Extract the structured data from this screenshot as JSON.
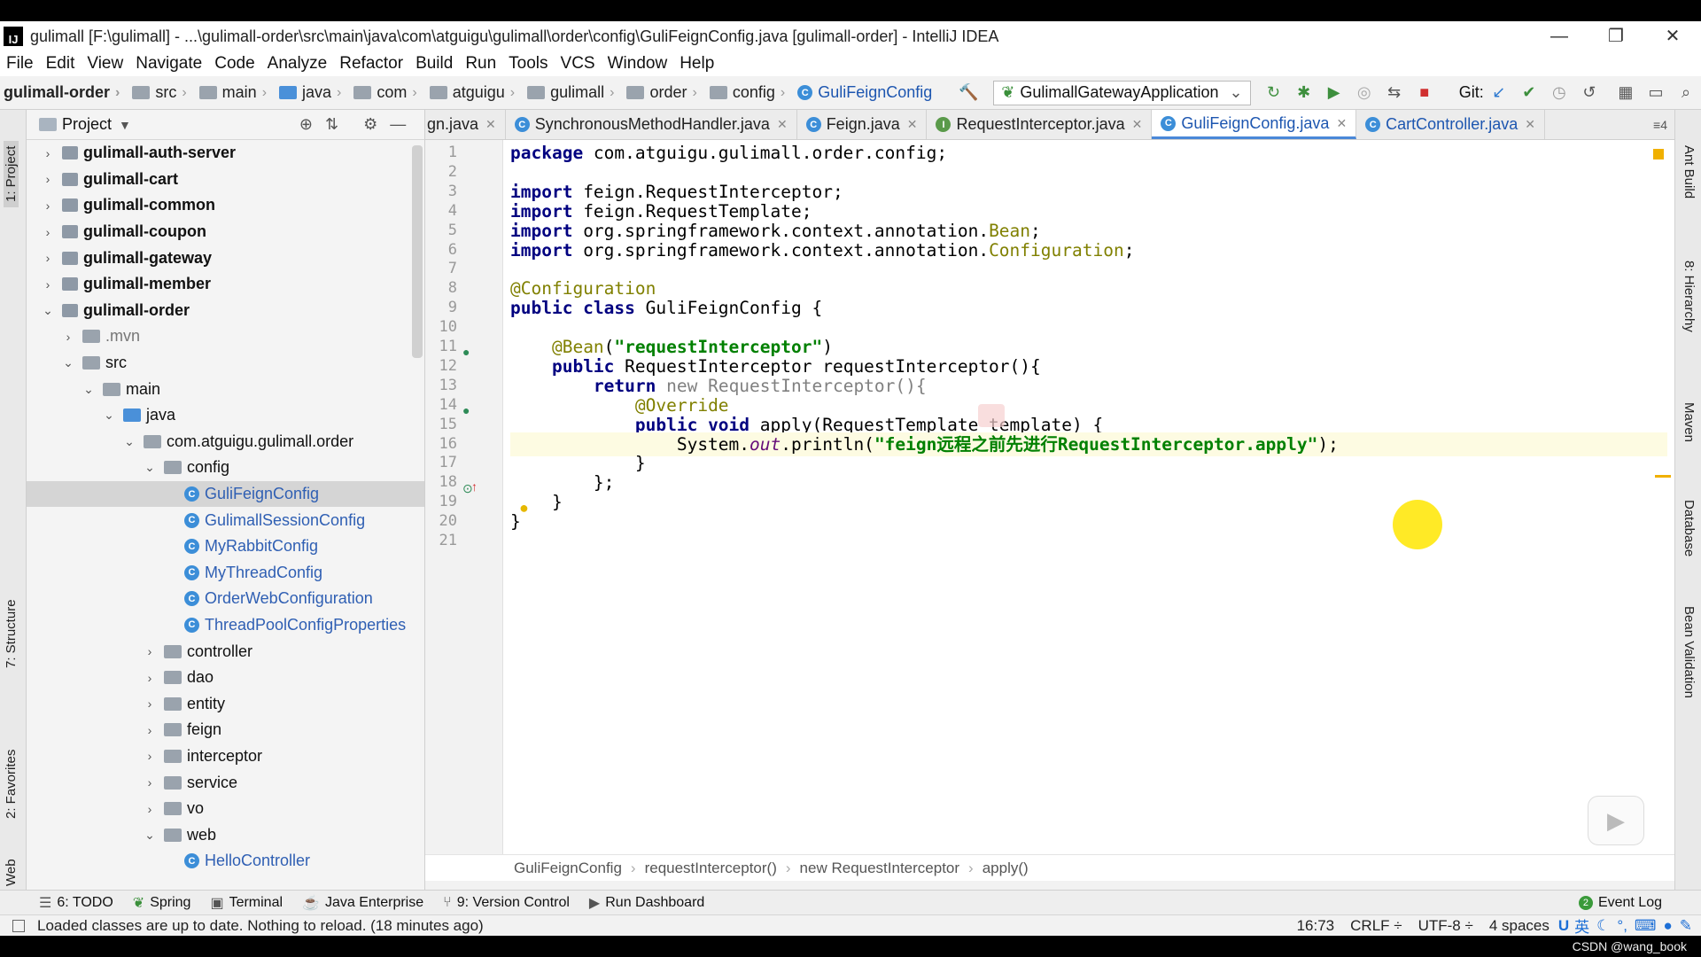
{
  "window": {
    "title": "gulimall [F:\\gulimall] - ...\\gulimall-order\\src\\main\\java\\com\\atguigu\\gulimall\\order\\config\\GuliFeignConfig.java [gulimall-order] - IntelliJ IDEA",
    "minimize": "—",
    "restore": "❐",
    "close": "✕"
  },
  "menu": [
    "File",
    "Edit",
    "View",
    "Navigate",
    "Code",
    "Analyze",
    "Refactor",
    "Build",
    "Run",
    "Tools",
    "VCS",
    "Window",
    "Help"
  ],
  "nav": {
    "module": "gulimall-order",
    "crumbs": [
      "src",
      "main",
      "java",
      "com",
      "atguigu",
      "gulimall",
      "order",
      "config"
    ],
    "file": "GuliFeignConfig",
    "run_config": "GulimallGatewayApplication",
    "git": "Git:"
  },
  "left_tabs": {
    "project": "1: Project",
    "structure": "7: Structure",
    "favorites": "2: Favorites",
    "web": "Web"
  },
  "right_tabs": {
    "ant": "Ant Build",
    "hierarchy": "8: Hierarchy",
    "maven": "Maven",
    "database": "Database",
    "bean": "Bean Validation"
  },
  "project": {
    "header": "Project",
    "rows": [
      {
        "indent": 0,
        "arrow": "›",
        "icon": "mod",
        "label": "gulimall-auth-server",
        "bold": true
      },
      {
        "indent": 0,
        "arrow": "›",
        "icon": "mod",
        "label": "gulimall-cart",
        "bold": true
      },
      {
        "indent": 0,
        "arrow": "›",
        "icon": "mod",
        "label": "gulimall-common",
        "bold": true
      },
      {
        "indent": 0,
        "arrow": "›",
        "icon": "mod",
        "label": "gulimall-coupon",
        "bold": true
      },
      {
        "indent": 0,
        "arrow": "›",
        "icon": "mod",
        "label": "gulimall-gateway",
        "bold": true
      },
      {
        "indent": 0,
        "arrow": "›",
        "icon": "mod",
        "label": "gulimall-member",
        "bold": true
      },
      {
        "indent": 0,
        "arrow": "⌄",
        "icon": "mod",
        "label": "gulimall-order",
        "bold": true
      },
      {
        "indent": 1,
        "arrow": "›",
        "icon": "fold",
        "label": ".mvn",
        "grey": true
      },
      {
        "indent": 1,
        "arrow": "⌄",
        "icon": "fold",
        "label": "src"
      },
      {
        "indent": 2,
        "arrow": "⌄",
        "icon": "fold",
        "label": "main"
      },
      {
        "indent": 3,
        "arrow": "⌄",
        "icon": "fold-blue",
        "label": "java"
      },
      {
        "indent": 4,
        "arrow": "⌄",
        "icon": "fold",
        "label": "com.atguigu.gulimall.order"
      },
      {
        "indent": 5,
        "arrow": "⌄",
        "icon": "fold",
        "label": "config"
      },
      {
        "indent": 6,
        "arrow": "",
        "icon": "cls",
        "label": "GuliFeignConfig",
        "blue": true,
        "selected": true
      },
      {
        "indent": 6,
        "arrow": "",
        "icon": "cls",
        "label": "GulimallSessionConfig",
        "blue": true
      },
      {
        "indent": 6,
        "arrow": "",
        "icon": "cls",
        "label": "MyRabbitConfig",
        "blue": true
      },
      {
        "indent": 6,
        "arrow": "",
        "icon": "cls",
        "label": "MyThreadConfig",
        "blue": true
      },
      {
        "indent": 6,
        "arrow": "",
        "icon": "cls",
        "label": "OrderWebConfiguration",
        "blue": true
      },
      {
        "indent": 6,
        "arrow": "",
        "icon": "cls",
        "label": "ThreadPoolConfigProperties",
        "blue": true
      },
      {
        "indent": 5,
        "arrow": "›",
        "icon": "fold",
        "label": "controller"
      },
      {
        "indent": 5,
        "arrow": "›",
        "icon": "fold",
        "label": "dao"
      },
      {
        "indent": 5,
        "arrow": "›",
        "icon": "fold",
        "label": "entity"
      },
      {
        "indent": 5,
        "arrow": "›",
        "icon": "fold",
        "label": "feign"
      },
      {
        "indent": 5,
        "arrow": "›",
        "icon": "fold",
        "label": "interceptor"
      },
      {
        "indent": 5,
        "arrow": "›",
        "icon": "fold",
        "label": "service"
      },
      {
        "indent": 5,
        "arrow": "›",
        "icon": "fold",
        "label": "vo"
      },
      {
        "indent": 5,
        "arrow": "⌄",
        "icon": "fold",
        "label": "web"
      },
      {
        "indent": 6,
        "arrow": "",
        "icon": "cls",
        "label": "HelloController",
        "blue": true
      }
    ]
  },
  "tabs": [
    {
      "label": "gn.java",
      "icon": "",
      "active": false
    },
    {
      "label": "SynchronousMethodHandler.java",
      "icon": "C",
      "active": false
    },
    {
      "label": "Feign.java",
      "icon": "C",
      "active": false
    },
    {
      "label": "RequestInterceptor.java",
      "icon": "I",
      "active": false
    },
    {
      "label": "GuliFeignConfig.java",
      "icon": "C",
      "active": true
    },
    {
      "label": "CartController.java",
      "icon": "C",
      "active": false
    }
  ],
  "tabs_more": "≡4",
  "code": {
    "line_numbers": [
      "1",
      "2",
      "3",
      "4",
      "5",
      "6",
      "7",
      "8",
      "9",
      "10",
      "11",
      "12",
      "13",
      "14",
      "15",
      "16",
      "17",
      "18",
      "19",
      "20",
      "21"
    ],
    "lines": [
      "<span class=\"kw\">package</span> com.atguigu.gulimall.order.config;",
      "",
      "<span class=\"kw\">import</span> feign.RequestInterceptor;",
      "<span class=\"kw\">import</span> feign.RequestTemplate;",
      "<span class=\"kw\">import</span> org.springframework.context.annotation.<span class=\"bean\">Bean</span>;",
      "<span class=\"kw\">import</span> org.springframework.context.annotation.<span class=\"bean\">Configuration</span>;",
      "",
      "<span class=\"ann\">@Configuration</span>",
      "<span class=\"kw\">public class</span> GuliFeignConfig {",
      "",
      "    <span class=\"ann\">@Bean</span>(<span class=\"str\">\"requestInterceptor\"</span>)",
      "    <span class=\"kw\">public</span> RequestInterceptor requestInterceptor(){",
      "        <span class=\"kw\">return</span> <span class=\"grey\">new RequestInterceptor(){</span>",
      "            <span class=\"ann\">@Override</span>",
      "            <span class=\"kw\">public void</span> apply(RequestTemplate template) {",
      "                System.<span class=\"fld\">out</span>.println(<span class=\"str\">\"feign远程之前先进行RequestInterceptor.apply\"</span>);",
      "            }",
      "        };",
      "    }",
      "}",
      ""
    ]
  },
  "breadcrumb": [
    "GuliFeignConfig",
    "requestInterceptor()",
    "new RequestInterceptor",
    "apply()"
  ],
  "toolwindows": [
    {
      "icon": "☰",
      "label": "6: TODO"
    },
    {
      "icon": "❦",
      "label": "Spring"
    },
    {
      "icon": "▣",
      "label": "Terminal"
    },
    {
      "icon": "☕",
      "label": "Java Enterprise"
    },
    {
      "icon": "⑂",
      "label": "9: Version Control"
    },
    {
      "icon": "▶",
      "label": "Run Dashboard"
    }
  ],
  "event_log": "Event Log",
  "event_badge": "2",
  "status": {
    "message": "Loaded classes are up to date. Nothing to reload. (18 minutes ago)",
    "position": "16:73",
    "line_sep": "CRLF ÷",
    "encoding": "UTF-8 ÷",
    "indent": "4 spaces",
    "ime": "英"
  },
  "watermark": "CSDN @wang_book"
}
